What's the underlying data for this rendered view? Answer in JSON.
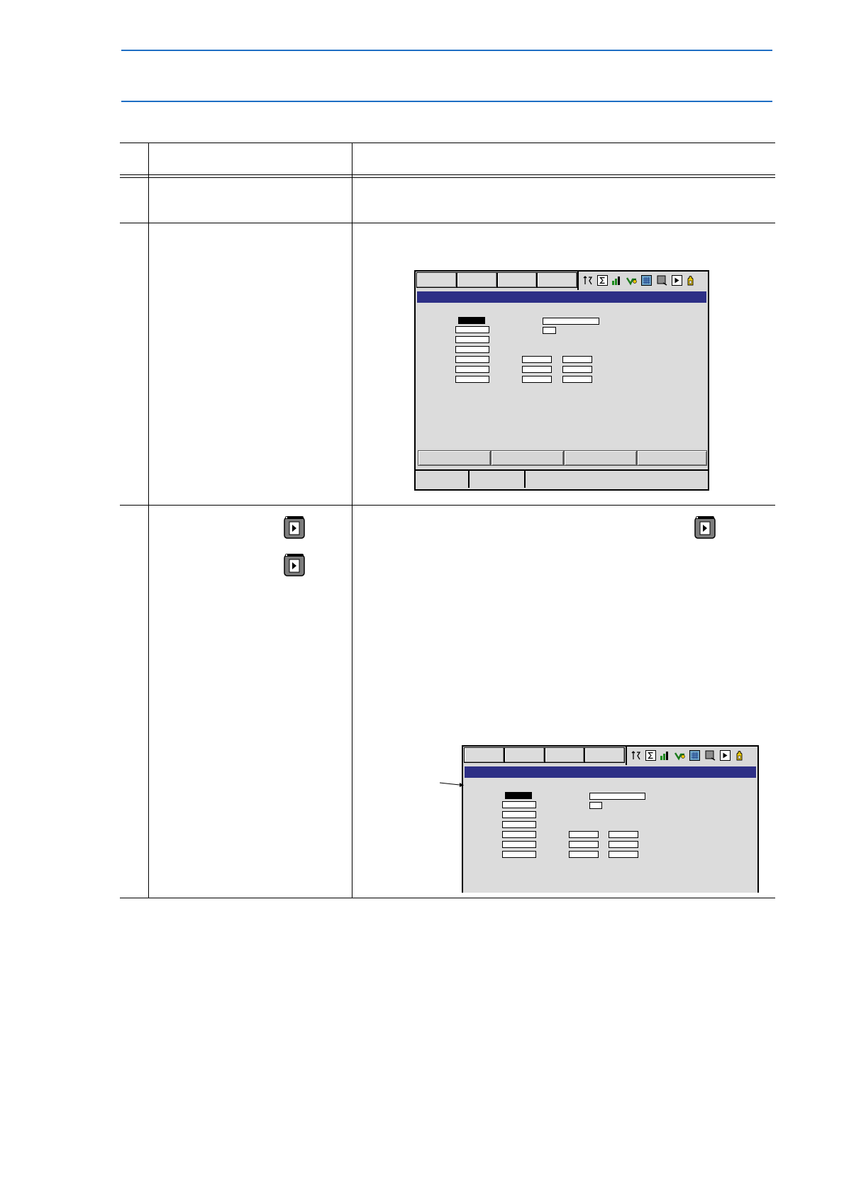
{
  "document": {
    "rule_color": "#1f6fc4",
    "page_key_icon": "page-key-icon"
  },
  "screens": {
    "title_bar_color": "#2d2f86",
    "background_color": "#d9d9d9",
    "status_icons": [
      "coordinate-icon",
      "sigma-icon",
      "level-icon",
      "tool-icon",
      "grid-icon",
      "display-icon",
      "page-icon",
      "hand-icon"
    ]
  }
}
